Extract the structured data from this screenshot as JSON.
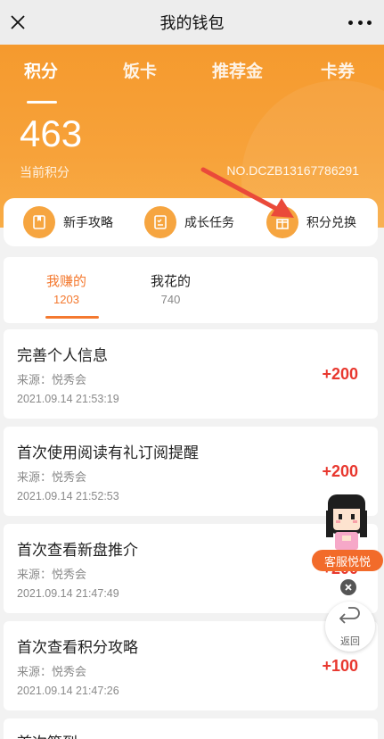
{
  "header": {
    "title": "我的钱包",
    "close_icon": "close-icon",
    "more_icon": "more-icon"
  },
  "banner": {
    "tabs": [
      {
        "label": "积分",
        "active": true
      },
      {
        "label": "饭卡",
        "active": false
      },
      {
        "label": "推荐金",
        "active": false
      },
      {
        "label": "卡券",
        "active": false
      }
    ],
    "points": "463",
    "points_label": "当前积分",
    "member_no": "NO.DCZB13167786291",
    "color": "#f7a23a"
  },
  "quick_actions": [
    {
      "label": "新手攻略",
      "icon": "guide-book-icon"
    },
    {
      "label": "成长任务",
      "icon": "task-list-icon"
    },
    {
      "label": "积分兑换",
      "icon": "gift-exchange-icon"
    }
  ],
  "switch": {
    "earned": {
      "label": "我赚的",
      "count": "1203"
    },
    "spent": {
      "label": "我花的",
      "count": "740"
    },
    "accent": "#f4792f"
  },
  "records": [
    {
      "title": "完善个人信息",
      "source": "来源：悦秀会",
      "time": "2021.09.14 21:53:19",
      "points": "+200"
    },
    {
      "title": "首次使用阅读有礼订阅提醒",
      "source": "来源：悦秀会",
      "time": "2021.09.14 21:52:53",
      "points": "+200"
    },
    {
      "title": "首次查看新盘推介",
      "source": "来源：悦秀会",
      "time": "2021.09.14 21:47:49",
      "points": "+200"
    },
    {
      "title": "首次查看积分攻略",
      "source": "来源：悦秀会",
      "time": "2021.09.14 21:47:26",
      "points": "+100"
    },
    {
      "title": "首次签到",
      "source": "",
      "time": "",
      "points": ""
    }
  ],
  "floating": {
    "customer_service_label": "客服悦悦",
    "back_label": "返回"
  }
}
